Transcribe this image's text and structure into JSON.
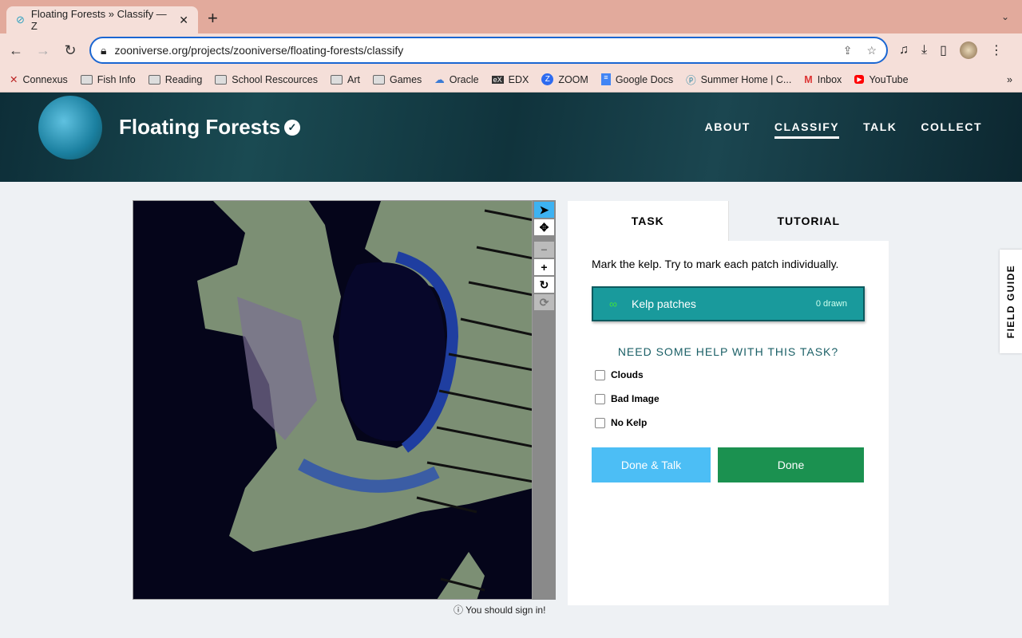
{
  "browser": {
    "tab_title": "Floating Forests » Classify — Z",
    "url": "zooniverse.org/projects/zooniverse/floating-forests/classify",
    "bookmarks": [
      "Connexus",
      "Fish Info",
      "Reading",
      "School Rescources",
      "Art",
      "Games",
      "Oracle",
      "EDX",
      "ZOOM",
      "Google Docs",
      "Summer Home | C...",
      "Inbox",
      "YouTube"
    ]
  },
  "project": {
    "title": "Floating Forests",
    "nav": [
      "ABOUT",
      "CLASSIFY",
      "TALK",
      "COLLECT"
    ]
  },
  "viewer": {
    "signin_notice": "You should sign in!"
  },
  "panel": {
    "tabs": [
      "TASK",
      "TUTORIAL"
    ],
    "instruction": "Mark the kelp. Try to mark each patch individually.",
    "tool_label": "Kelp patches",
    "tool_count": "0 drawn",
    "help": "NEED SOME HELP WITH THIS TASK?",
    "checkboxes": [
      "Clouds",
      "Bad Image",
      "No Kelp"
    ],
    "done_talk": "Done & Talk",
    "done": "Done"
  },
  "field_guide": "FIELD GUIDE"
}
